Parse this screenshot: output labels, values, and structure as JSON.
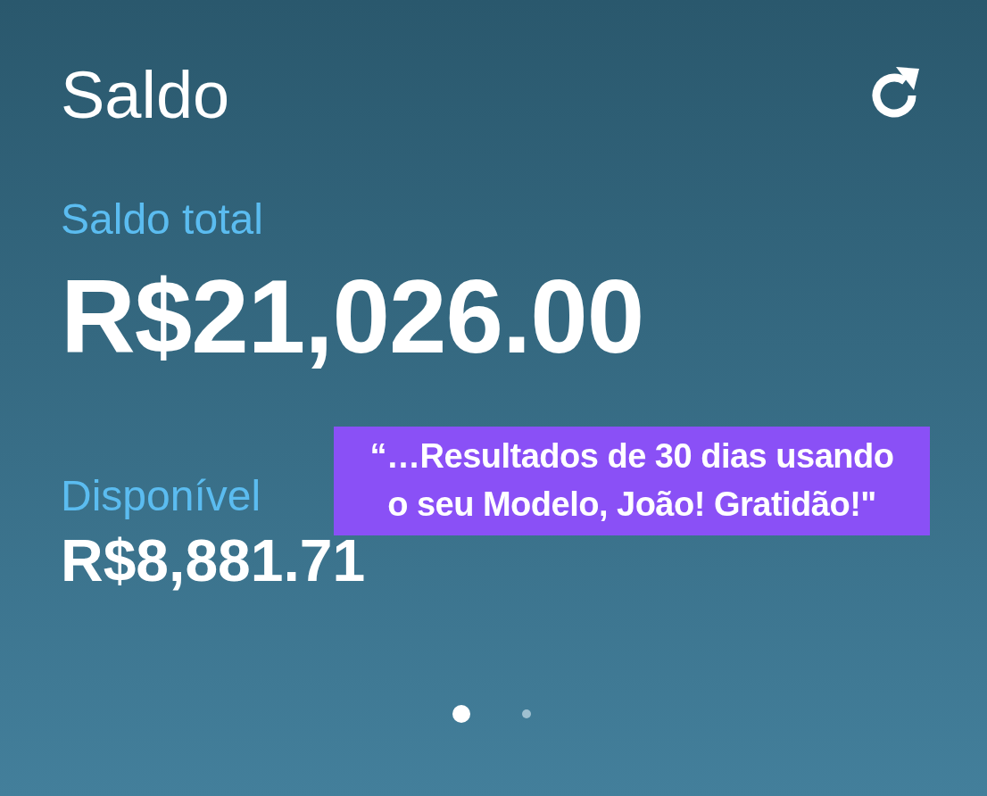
{
  "header": {
    "title": "Saldo"
  },
  "balance": {
    "total_label": "Saldo total",
    "total_amount": "R$21,026.00",
    "available_label": "Disponível",
    "available_amount": "R$8,881.71"
  },
  "caption": {
    "lines": [
      "“…Resultados de 30 dias usando",
      "o seu Modelo, João! Gratidão!\""
    ]
  },
  "pager": [
    {
      "selected": true
    },
    {
      "selected": false
    }
  ]
}
